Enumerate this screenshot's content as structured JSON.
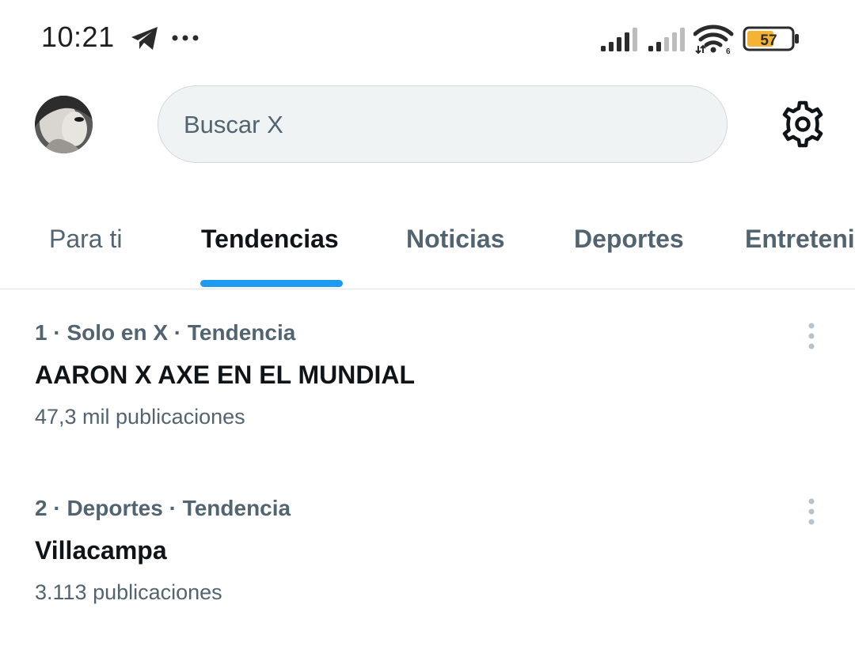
{
  "status_bar": {
    "time": "10:21",
    "battery_level": "57",
    "wifi_badge": "6",
    "icons": [
      "telegram-icon",
      "more-dots-icon",
      "signal-icon",
      "signal-icon",
      "wifi-icon",
      "battery-icon"
    ]
  },
  "header": {
    "search_placeholder": "Buscar X",
    "settings_icon": "gear-icon"
  },
  "tabs": [
    {
      "label": "Para ti",
      "active": false
    },
    {
      "label": "Tendencias",
      "active": true
    },
    {
      "label": "Noticias",
      "active": false
    },
    {
      "label": "Deportes",
      "active": false
    },
    {
      "label": "Entreteni",
      "active": false
    }
  ],
  "trends": [
    {
      "meta": "1 · Solo en X · Tendencia",
      "title": "AARON X AXE EN EL MUNDIAL",
      "count": "47,3 mil publicaciones"
    },
    {
      "meta": "2 · Deportes · Tendencia",
      "title": "Villacampa",
      "count": "3.113 publicaciones"
    }
  ],
  "colors": {
    "accent": "#1d9bf0",
    "text_primary": "#0f1419",
    "text_secondary": "#536471",
    "search_bg": "#eff3f4",
    "battery_fill": "#f5b335"
  }
}
